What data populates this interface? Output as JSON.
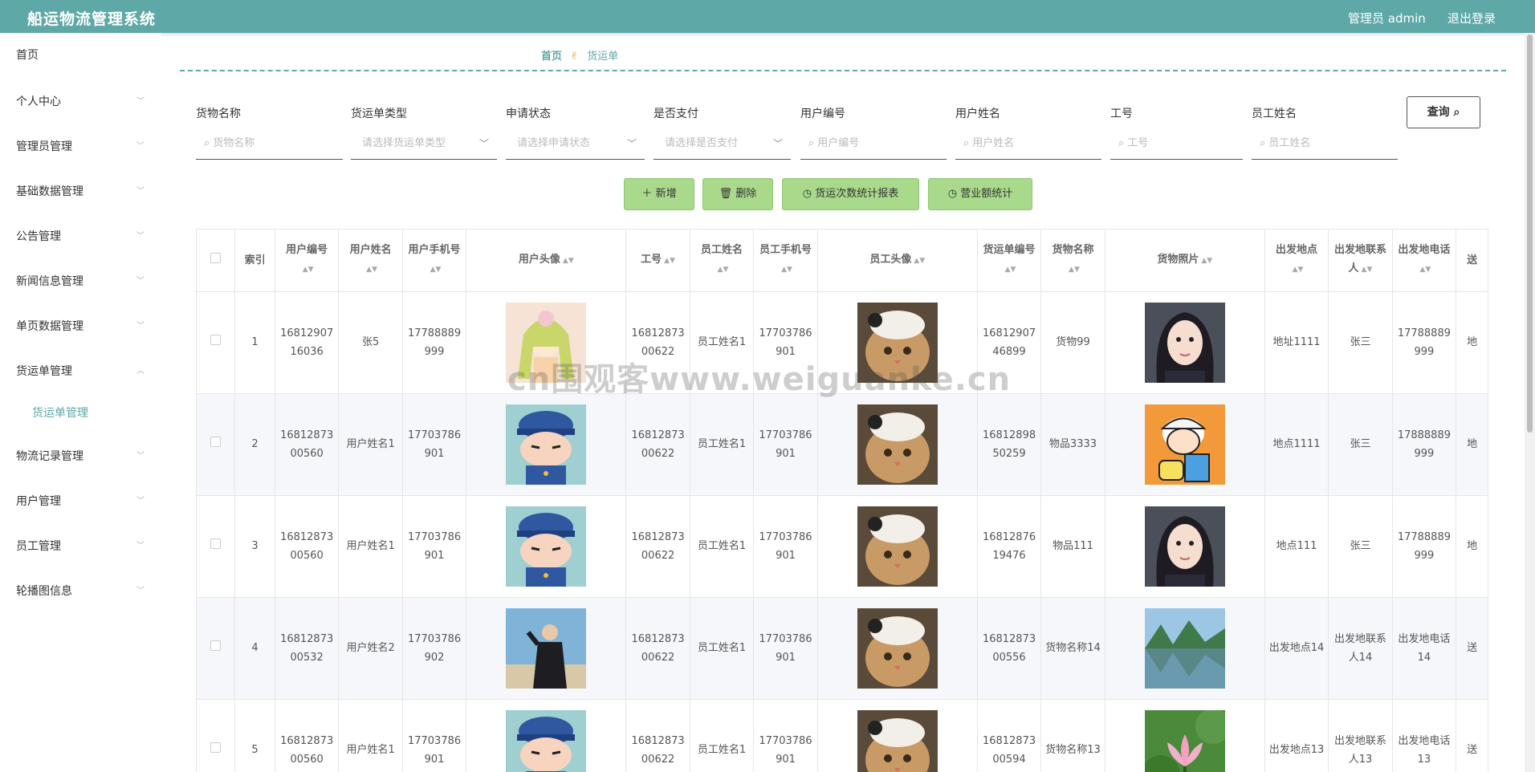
{
  "header": {
    "title": "船运物流管理系统",
    "user": "管理员 admin",
    "logout": "退出登录"
  },
  "sidebar": {
    "items": [
      {
        "label": "首页",
        "chevron": false
      },
      {
        "label": "个人中心",
        "chevron": true
      },
      {
        "label": "管理员管理",
        "chevron": true
      },
      {
        "label": "基础数据管理",
        "chevron": true
      },
      {
        "label": "公告管理",
        "chevron": true
      },
      {
        "label": "新闻信息管理",
        "chevron": true
      },
      {
        "label": "单页数据管理",
        "chevron": true
      },
      {
        "label": "货运单管理",
        "chevron": true,
        "expanded": true
      },
      {
        "label": "物流记录管理",
        "chevron": true
      },
      {
        "label": "用户管理",
        "chevron": true
      },
      {
        "label": "员工管理",
        "chevron": true
      },
      {
        "label": "轮播图信息",
        "chevron": true
      }
    ],
    "sub_item": "货运单管理"
  },
  "breadcrumb": {
    "home": "首页",
    "current": "货运单"
  },
  "filters": [
    {
      "label": "货物名称",
      "placeholder": "货物名称",
      "type": "input"
    },
    {
      "label": "货运单类型",
      "placeholder": "请选择货运单类型",
      "type": "select"
    },
    {
      "label": "申请状态",
      "placeholder": "请选择申请状态",
      "type": "select"
    },
    {
      "label": "是否支付",
      "placeholder": "请选择是否支付",
      "type": "select"
    },
    {
      "label": "用户编号",
      "placeholder": "用户编号",
      "type": "input"
    },
    {
      "label": "用户姓名",
      "placeholder": "用户姓名",
      "type": "input"
    },
    {
      "label": "工号",
      "placeholder": "工号",
      "type": "input"
    },
    {
      "label": "员工姓名",
      "placeholder": "员工姓名",
      "type": "input"
    }
  ],
  "query_button": "查询",
  "actions": [
    {
      "label": "新增",
      "icon": "plus-icon"
    },
    {
      "label": "删除",
      "icon": "trash-icon"
    },
    {
      "label": "货运次数统计报表",
      "icon": "pie-icon"
    },
    {
      "label": "营业额统计",
      "icon": "pie-icon"
    }
  ],
  "table": {
    "headers": [
      "索引",
      "用户编号",
      "用户姓名",
      "用户手机号",
      "用户头像",
      "工号",
      "员工姓名",
      "员工手机号",
      "员工头像",
      "货运单编号",
      "货物名称",
      "货物照片",
      "出发地点",
      "出发地联系人",
      "出发地电话",
      "送"
    ],
    "rows": [
      {
        "index": "1",
        "user_no": "1681290716036",
        "user_name": "张5",
        "user_phone": "17788889999",
        "avatar": "anime-girl",
        "staff_no": "1681287300622",
        "staff_name": "员工姓名1",
        "staff_phone": "17703786901",
        "staff_avatar": "cat",
        "order_no": "1681290746899",
        "goods": "货物99",
        "goods_photo": "woman-portrait",
        "from": "地址1111",
        "contact": "张三",
        "phone": "17788889999",
        "to": "地"
      },
      {
        "index": "2",
        "user_no": "1681287300560",
        "user_name": "用户姓名1",
        "user_phone": "17703786901",
        "avatar": "cartoon-boy",
        "staff_no": "1681287300622",
        "staff_name": "员工姓名1",
        "staff_phone": "17703786901",
        "staff_avatar": "cat",
        "order_no": "1681289850259",
        "goods": "物品3333",
        "goods_photo": "cartoon-kid",
        "from": "地点1111",
        "contact": "张三",
        "phone": "17888889999",
        "to": "地"
      },
      {
        "index": "3",
        "user_no": "1681287300560",
        "user_name": "用户姓名1",
        "user_phone": "17703786901",
        "avatar": "cartoon-boy",
        "staff_no": "1681287300622",
        "staff_name": "员工姓名1",
        "staff_phone": "17703786901",
        "staff_avatar": "cat",
        "order_no": "1681287619476",
        "goods": "物品111",
        "goods_photo": "woman-portrait",
        "from": "地点111",
        "contact": "张三",
        "phone": "17788889999",
        "to": "地"
      },
      {
        "index": "4",
        "user_no": "1681287300532",
        "user_name": "用户姓名2",
        "user_phone": "17703786902",
        "avatar": "man-photo",
        "staff_no": "1681287300622",
        "staff_name": "员工姓名1",
        "staff_phone": "17703786901",
        "staff_avatar": "cat",
        "order_no": "1681287300556",
        "goods": "货物名称14",
        "goods_photo": "landscape",
        "from": "出发地点14",
        "contact": "出发地联系人14",
        "phone": "出发地电话14",
        "to": "送"
      },
      {
        "index": "5",
        "user_no": "1681287300560",
        "user_name": "用户姓名1",
        "user_phone": "17703786901",
        "avatar": "cartoon-boy",
        "staff_no": "1681287300622",
        "staff_name": "员工姓名1",
        "staff_phone": "17703786901",
        "staff_avatar": "cat",
        "order_no": "1681287300594",
        "goods": "货物名称13",
        "goods_photo": "lotus",
        "from": "出发地点13",
        "contact": "出发地联系人13",
        "phone": "出发地电话13",
        "to": "送"
      }
    ]
  },
  "watermark": "cn围观客www.weiguanke.cn",
  "colors": {
    "primary": "#5fa8a8",
    "action_button": "#a9d98b",
    "row_alt": "#f5f7fa"
  }
}
